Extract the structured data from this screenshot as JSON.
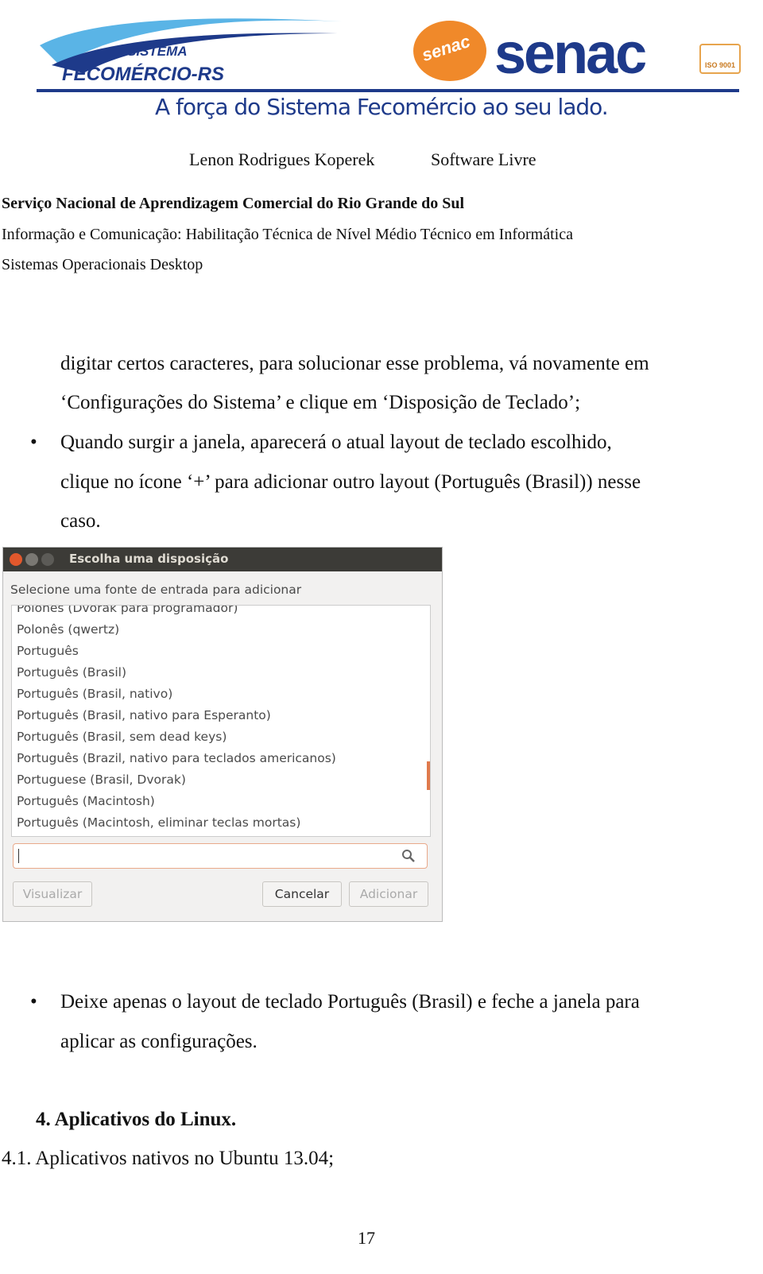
{
  "header": {
    "logo_left_line1": "SISTEMA",
    "logo_left_line2": "FECOMÉRCIO-RS",
    "logo_right": "senac",
    "logo_right_mark": "senac",
    "iso": "ISO 9001",
    "tagline": "A força do Sistema Fecomércio ao seu lado.",
    "brand_color": "#1e3a8a",
    "accent_color": "#f0892a"
  },
  "meta": {
    "author": "Lenon Rodrigues Koperek",
    "subject": "Software Livre",
    "institution": "Serviço Nacional de Aprendizagem Comercial do Rio Grande do Sul",
    "course": "Informação e Comunicação: Habilitação Técnica de Nível Médio Técnico em Informática",
    "module": "Sistemas Operacionais Desktop"
  },
  "content": {
    "para1_line1": "digitar certos caracteres, para solucionar esse problema, vá novamente em",
    "para1_line2": "‘Configurações do Sistema’ e clique em ‘Disposição de Teclado’;",
    "bullet1_line1": "Quando surgir a janela, aparecerá o atual layout de teclado escolhido,",
    "bullet1_line2": "clique no ícone ‘+’ para adicionar outro layout (Português (Brasil)) nesse",
    "bullet1_line3": "caso.",
    "bullet2_line1": "Deixe apenas o layout de teclado Português (Brasil) e feche a janela para",
    "bullet2_line2": "aplicar as configurações.",
    "section": "4. Aplicativos do Linux.",
    "subsection": "4.1. Aplicativos nativos no Ubuntu 13.04;",
    "page_number": "17"
  },
  "dialog": {
    "title": "Escolha uma disposição",
    "prompt": "Selecione uma fonte de entrada para adicionar",
    "items": [
      "Polonês (Dvorak para programador)",
      "Polonês (qwertz)",
      "Português",
      "Português (Brasil)",
      "Português (Brasil, nativo)",
      "Português (Brasil, nativo para Esperanto)",
      "Português (Brasil, sem dead keys)",
      "Português (Brazil, nativo para teclados americanos)",
      "Portuguese (Brasil, Dvorak)",
      "Português (Macintosh)",
      "Português (Macintosh, eliminar teclas mortas)"
    ],
    "search_value": "",
    "preview_label": "Visualizar",
    "cancel_label": "Cancelar",
    "add_label": "Adicionar"
  }
}
